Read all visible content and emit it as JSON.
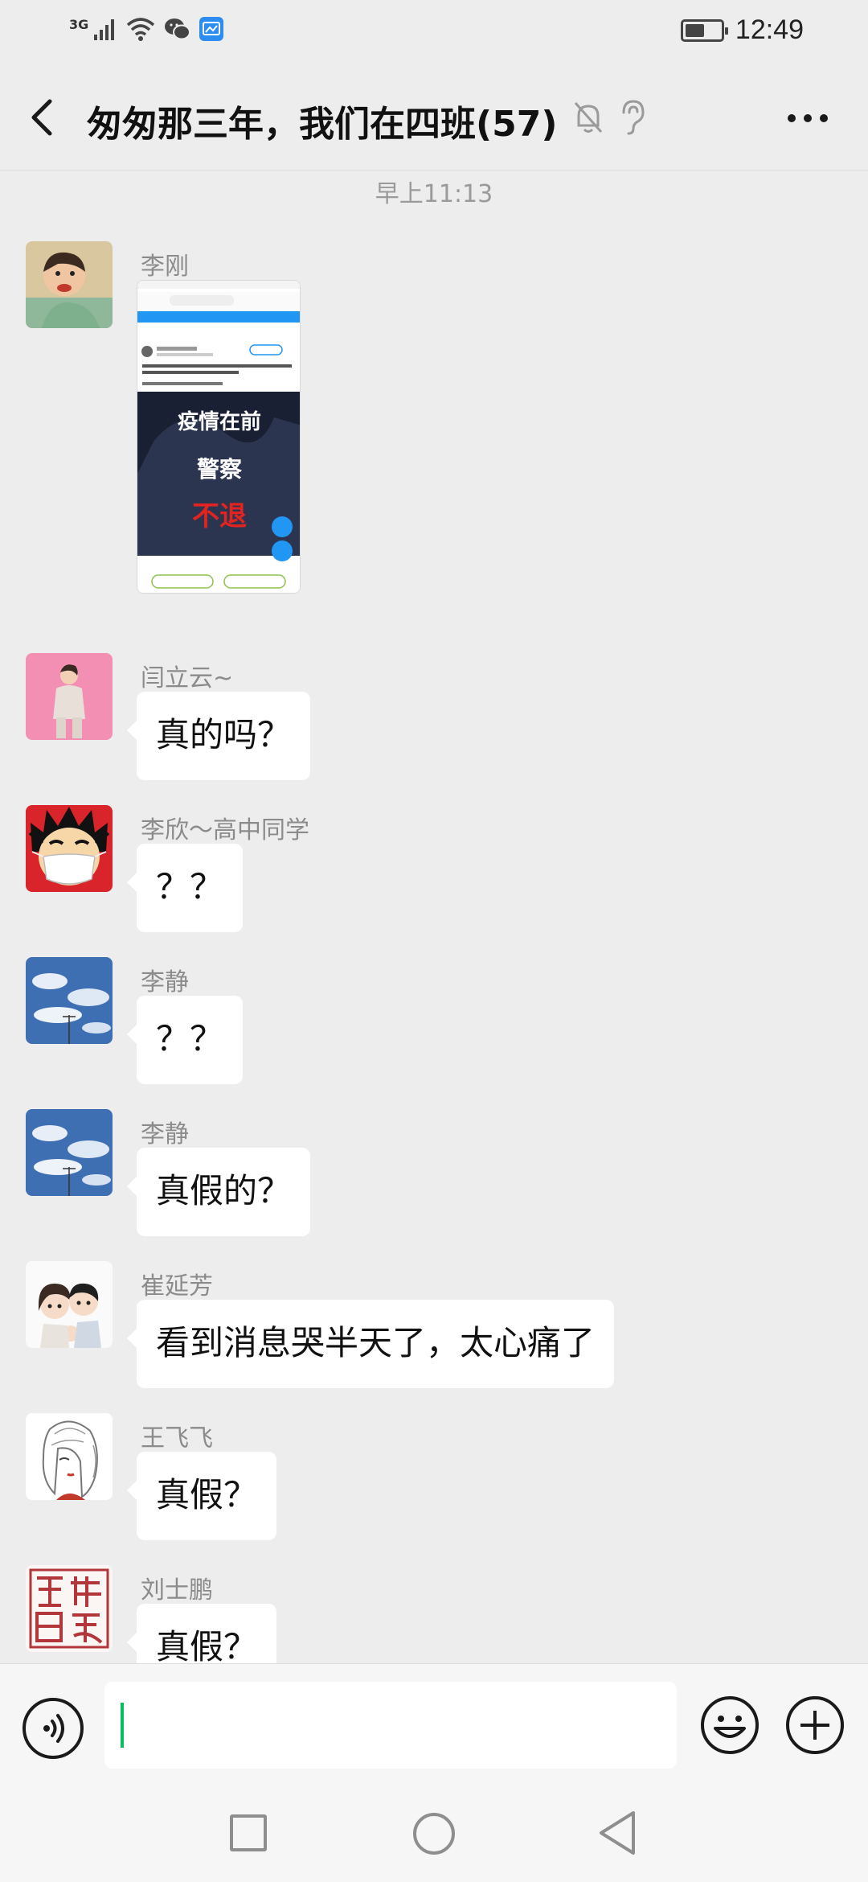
{
  "status_bar": {
    "network": "3G",
    "time": "12:49",
    "battery_fraction": 0.55
  },
  "header": {
    "title": "匆匆那三年，我们在四班(57)"
  },
  "chat": {
    "timestamp": "早上11:13",
    "image_message": {
      "sender": "李刚",
      "image_caption_lines": [
        "疫情在前",
        "警察",
        "不退"
      ]
    },
    "messages": [
      {
        "sender": "闫立云~",
        "text": "真的吗？"
      },
      {
        "sender": "李欣～高中同学",
        "text": "？？"
      },
      {
        "sender": "李静",
        "text": "？？"
      },
      {
        "sender": "李静",
        "text": "真假的？"
      },
      {
        "sender": "崔延芳",
        "text": "看到消息哭半天了，太心痛了"
      },
      {
        "sender": "王飞飞",
        "text": "真假？"
      },
      {
        "sender": "刘士鹏",
        "text": "真假？"
      }
    ]
  },
  "input": {
    "value": ""
  },
  "colors": {
    "accent": "#07c160",
    "background": "#ededed",
    "bubble": "#ffffff"
  }
}
